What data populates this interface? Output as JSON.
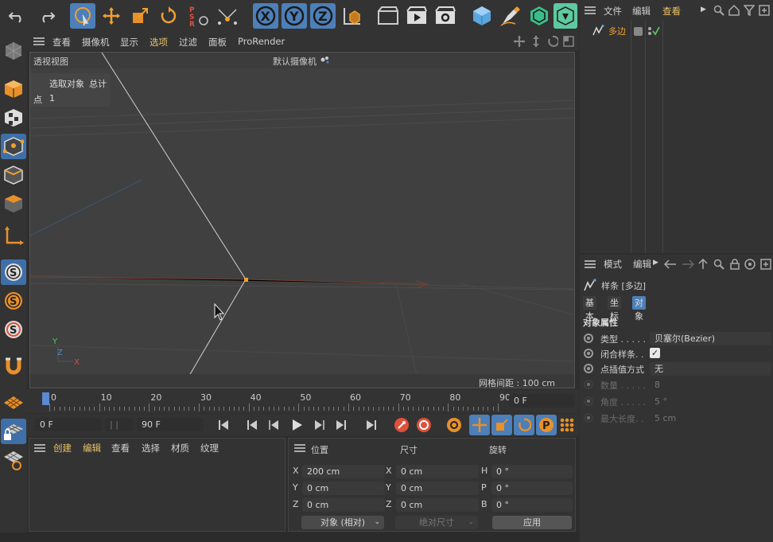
{
  "top_menu": {
    "view_menu": [
      "查看",
      "摄像机",
      "显示",
      "选项",
      "过滤",
      "面板",
      "ProRender"
    ],
    "active_view_item": "选项"
  },
  "viewport": {
    "title": "透视视图",
    "camera": "默认摄像机",
    "info_header_selected": "选取对象",
    "info_header_total": "总计",
    "info_row_label": "点",
    "info_row_value": "1",
    "grid_spacing": "网格间距 : 100 cm"
  },
  "timeline": {
    "ticks": [
      "0",
      "10",
      "20",
      "30",
      "40",
      "50",
      "60",
      "70",
      "80",
      "90"
    ],
    "current_frame": "0 F",
    "start_frame": "0 F",
    "end_frame": "90 F"
  },
  "object_manager": {
    "menu": [
      "文件",
      "编辑",
      "查看"
    ],
    "active_menu": "查看",
    "objects": [
      {
        "name": "多边"
      }
    ]
  },
  "material_manager": {
    "menu": [
      "创建",
      "编辑",
      "查看",
      "选择",
      "材质",
      "纹理"
    ]
  },
  "coordinates": {
    "headers": [
      "位置",
      "尺寸",
      "旋转"
    ],
    "rows": [
      {
        "pos_axis": "X",
        "pos": "200 cm",
        "size_axis": "X",
        "size": "0 cm",
        "rot_axis": "H",
        "rot": "0 °"
      },
      {
        "pos_axis": "Y",
        "pos": "0 cm",
        "size_axis": "Y",
        "size": "0 cm",
        "rot_axis": "P",
        "rot": "0 °"
      },
      {
        "pos_axis": "Z",
        "pos": "0 cm",
        "size_axis": "Z",
        "size": "0 cm",
        "rot_axis": "B",
        "rot": "0 °"
      }
    ],
    "mode_select": "对象 (相对)",
    "size_select": "绝对尺寸",
    "apply_label": "应用"
  },
  "attributes": {
    "menu_mode": "模式",
    "menu_edit": "编辑",
    "object_title": "样条 [多边]",
    "tabs": [
      "基本",
      "坐标",
      "对象"
    ],
    "active_tab": "对象",
    "section": "对象属性",
    "props": [
      {
        "label": "类型 . . . . .",
        "value": "贝塞尔(Bezier)",
        "enabled": true
      },
      {
        "label": "闭合样条. .",
        "value": "",
        "checkbox": true,
        "enabled": true
      },
      {
        "label": "点插值方式",
        "value": "无",
        "enabled": true
      },
      {
        "label": "数量 . . . . .",
        "value": "8",
        "enabled": false
      },
      {
        "label": "角度 . . . . .",
        "value": "5 °",
        "enabled": false
      },
      {
        "label": "最大长度. .",
        "value": "5 cm",
        "enabled": false
      }
    ]
  },
  "colors": {
    "accent_blue": "#3f6fa8",
    "accent_orange": "#e8902a",
    "active_menu": "#e8c36a"
  }
}
